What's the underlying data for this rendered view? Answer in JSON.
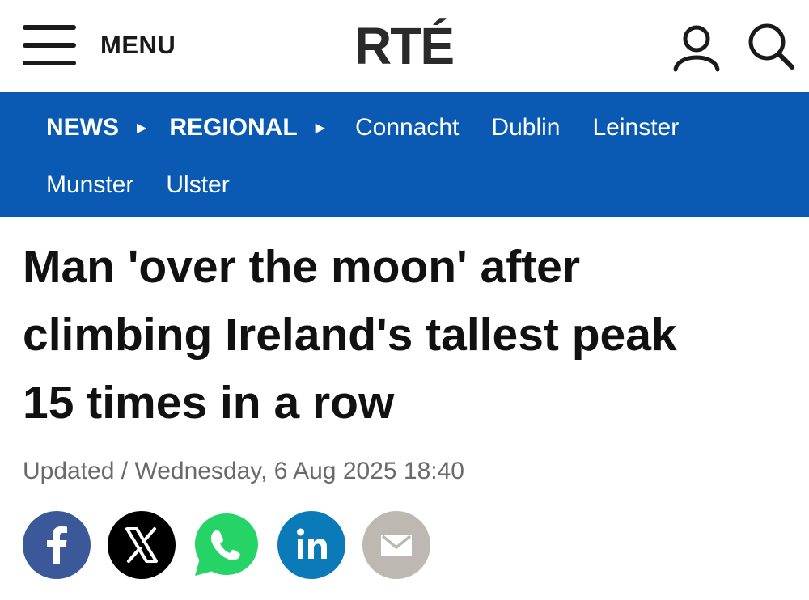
{
  "header": {
    "menu_label": "MENU",
    "logo_text": "RTÉ"
  },
  "nav": {
    "breadcrumb": [
      {
        "label": "NEWS"
      },
      {
        "label": "REGIONAL"
      }
    ],
    "regions_row1": [
      "Connacht",
      "Dublin",
      "Leinster"
    ],
    "regions_row2": [
      "Munster",
      "Ulster"
    ]
  },
  "article": {
    "headline_lines": [
      "Man 'over the moon' after",
      "climbing Ireland's tallest peak",
      "15 times in a row"
    ],
    "updated": "Updated / Wednesday, 6 Aug 2025 18:40"
  },
  "share": [
    {
      "icon": "facebook-icon",
      "color": "#3b5998"
    },
    {
      "icon": "x-icon",
      "color": "#000000"
    },
    {
      "icon": "whatsapp-icon",
      "color": "#25d366"
    },
    {
      "icon": "linkedin-icon",
      "color": "#0a7ab8"
    },
    {
      "icon": "email-icon",
      "color": "#bdb8b1"
    }
  ],
  "colors": {
    "nav_background": "#0a5ab4",
    "headline_text": "#111111",
    "meta_text": "#6a6a6a"
  }
}
